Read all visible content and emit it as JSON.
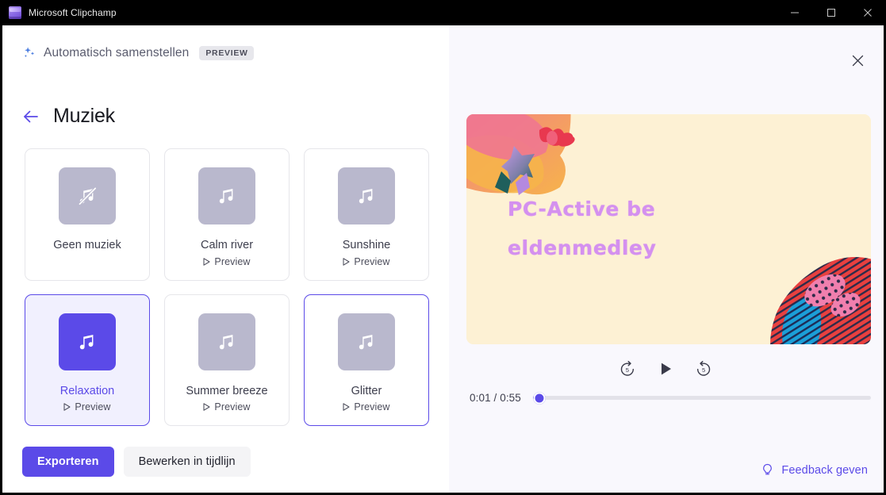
{
  "window": {
    "title": "Microsoft Clipchamp",
    "app_icon": "clipchamp-logo-icon",
    "controls": {
      "minimize": "minimize-icon",
      "maximize": "maximize-icon",
      "close": "close-icon"
    }
  },
  "header": {
    "sparkle_icon": "sparkle-icon",
    "brand_label": "Automatisch samenstellen",
    "badge": "PREVIEW",
    "back_icon": "back-arrow-icon",
    "page_title": "Muziek",
    "close_icon": "close-icon"
  },
  "music": {
    "preview_label": "Preview",
    "cards": [
      {
        "title": "Geen muziek",
        "icon": "music-note-muted-icon",
        "has_preview": false,
        "selected": false,
        "focused": false
      },
      {
        "title": "Calm river",
        "icon": "music-note-icon",
        "has_preview": true,
        "selected": false,
        "focused": false
      },
      {
        "title": "Sunshine",
        "icon": "music-note-icon",
        "has_preview": true,
        "selected": false,
        "focused": false
      },
      {
        "title": "Relaxation",
        "icon": "music-note-icon",
        "has_preview": true,
        "selected": true,
        "focused": false
      },
      {
        "title": "Summer breeze",
        "icon": "music-note-icon",
        "has_preview": true,
        "selected": false,
        "focused": false
      },
      {
        "title": "Glitter",
        "icon": "music-note-icon",
        "has_preview": true,
        "selected": false,
        "focused": true
      }
    ]
  },
  "actions": {
    "export_label": "Exporteren",
    "edit_timeline_label": "Bewerken in tijdlijn"
  },
  "player": {
    "video_title_text": "PC-Active be\neldenmedley",
    "rewind_icon": "rewind-5-icon",
    "play_icon": "play-icon",
    "forward_icon": "forward-5-icon",
    "current_time": "0:01",
    "total_time": "0:55",
    "time_display": "0:01 / 0:55",
    "progress_percent": 2
  },
  "feedback": {
    "icon": "lightbulb-icon",
    "label": "Feedback geven"
  },
  "colors": {
    "accent": "#5b4ae8",
    "accent_soft": "#f1f0fe",
    "panel_bg": "#f9f8fd",
    "thumb_gray": "#b9b8cd",
    "video_bg": "#fdf1d4",
    "video_text": "#d490ef",
    "titlebar_bg": "#000000",
    "sparkle_blue": "#4a7ce0"
  }
}
